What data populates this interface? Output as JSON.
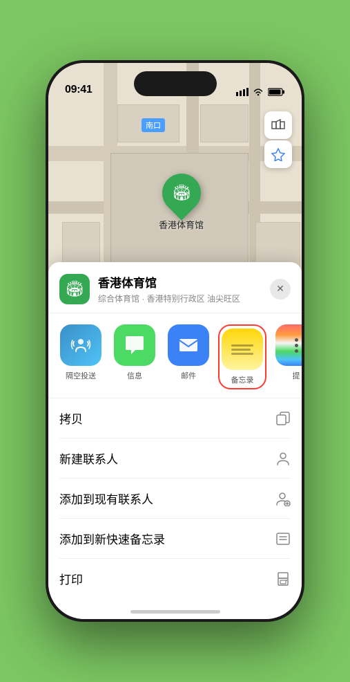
{
  "statusBar": {
    "time": "09:41",
    "timeIcon": "▶",
    "signalBars": "▌▌▌",
    "wifi": "WiFi",
    "battery": "Battery"
  },
  "map": {
    "label": "南口",
    "mapButtonTop": "🗺",
    "mapButtonBottom": "↗",
    "locationPin": "🏟",
    "venueName": "香港体育馆",
    "venuePinLabel": "香港体育馆"
  },
  "venueCard": {
    "icon": "🏟",
    "name": "香港体育馆",
    "subtitle": "综合体育馆 · 香港特别行政区 油尖旺区",
    "closeLabel": "✕"
  },
  "shareActions": [
    {
      "id": "airdrop",
      "label": "隔空投送",
      "type": "airdrop"
    },
    {
      "id": "messages",
      "label": "信息",
      "type": "messages"
    },
    {
      "id": "mail",
      "label": "邮件",
      "type": "mail"
    },
    {
      "id": "notes",
      "label": "备忘录",
      "type": "notes"
    },
    {
      "id": "more",
      "label": "提",
      "type": "more"
    }
  ],
  "actionItems": [
    {
      "label": "拷贝",
      "icon": "⊡"
    },
    {
      "label": "新建联系人",
      "icon": "👤"
    },
    {
      "label": "添加到现有联系人",
      "icon": "👤+"
    },
    {
      "label": "添加到新快速备忘录",
      "icon": "⊟"
    },
    {
      "label": "打印",
      "icon": "🖨"
    }
  ]
}
